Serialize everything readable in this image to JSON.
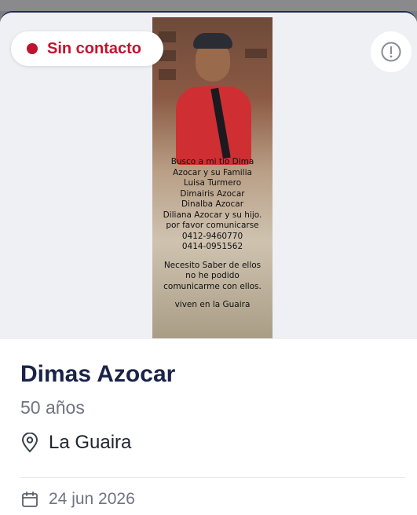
{
  "status_badge": {
    "label": "Sin contacto",
    "color": "#c0142e"
  },
  "info_button": {
    "icon": "exclamation-circle-icon"
  },
  "poster_text": {
    "lines": [
      "Busco a mi tio Dima",
      "Azocar y su Familia",
      "Luisa Turmero",
      "Dimairis Azocar",
      "Dinalba Azocar",
      "Diliana Azocar y su hijo.",
      "por favor comunicarse",
      "0412-9460770",
      "0414-0951562",
      "Necesito Saber de ellos",
      "no he podido",
      "comunicarme con ellos.",
      "viven en la Guaira"
    ]
  },
  "person": {
    "name": "Dimas Azocar",
    "age": "50 años",
    "location": "La Guaira",
    "location_icon": "map-pin-icon",
    "date": "24 jun 2026",
    "date_icon": "calendar-icon"
  }
}
